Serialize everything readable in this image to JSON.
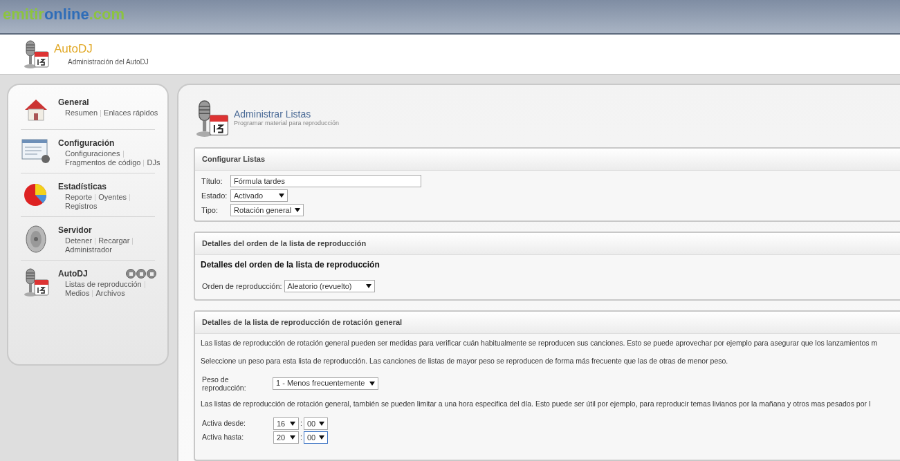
{
  "brand": {
    "part1": "emitir",
    "part2": "online",
    "part3": ".com"
  },
  "header": {
    "title": "AutoDJ",
    "subtitle": "Administración del AutoDJ"
  },
  "sidebar": {
    "items": [
      {
        "title": "General",
        "links": [
          "Resumen",
          "Enlaces rápidos"
        ],
        "controls": false
      },
      {
        "title": "Configuración",
        "links": [
          "Configuraciones",
          "Fragmentos de código",
          "DJs"
        ],
        "controls": false
      },
      {
        "title": "Estadísticas",
        "links": [
          "Reporte",
          "Oyentes",
          "Registros"
        ],
        "controls": false
      },
      {
        "title": "Servidor",
        "links": [
          "Detener",
          "Recargar",
          "Administrador"
        ],
        "controls": false
      },
      {
        "title": "AutoDJ",
        "links": [
          "Listas de reproducción",
          "Medios",
          "Archivos"
        ],
        "controls": true
      }
    ]
  },
  "page": {
    "title": "Administrar Listas",
    "subtitle": "Programar material para reproducción"
  },
  "configurar": {
    "heading": "Configurar Listas",
    "titulo_label": "Título:",
    "titulo_value": "Fórmula tardes",
    "estado_label": "Estado:",
    "estado_value": "Activado",
    "tipo_label": "Tipo:",
    "tipo_value": "Rotación general"
  },
  "orden": {
    "heading": "Detalles del orden de la lista de reproducción",
    "subheading": "Detalles del orden de la lista de reproducción",
    "label": "Orden de reproducción:",
    "value": "Aleatorio (revuelto)"
  },
  "rotacion": {
    "heading": "Detalles de la lista de reproducción de rotación general",
    "paragraph_1": "Las listas de reproducción de rotación general pueden ser medidas para verificar cuán habitualmente se reproducen sus canciones. Esto se puede aprovechar por ejemplo para asegurar que los lanzamientos m",
    "paragraph_2": "Seleccione un peso para esta lista de reproducción. Las canciones de listas de mayor peso se reproducen de forma más frecuente que las de otras de menor peso.",
    "peso_label": "Peso de reproducción:",
    "peso_value": "1 - Menos frecuentemente",
    "paragraph_3": "Las listas de reproducción de rotación general, también se pueden limitar a una hora especifica del día. Esto puede ser útil por ejemplo, para reproducir temas livianos por la mañana y otros mas pesados por l",
    "times": [
      {
        "label": "Activa desde:",
        "hour": "16",
        "separator": ":",
        "minute": "00",
        "focused": false
      },
      {
        "label": "Activa hasta:",
        "hour": "20",
        "separator": ":",
        "minute": "00",
        "focused": true
      }
    ]
  }
}
